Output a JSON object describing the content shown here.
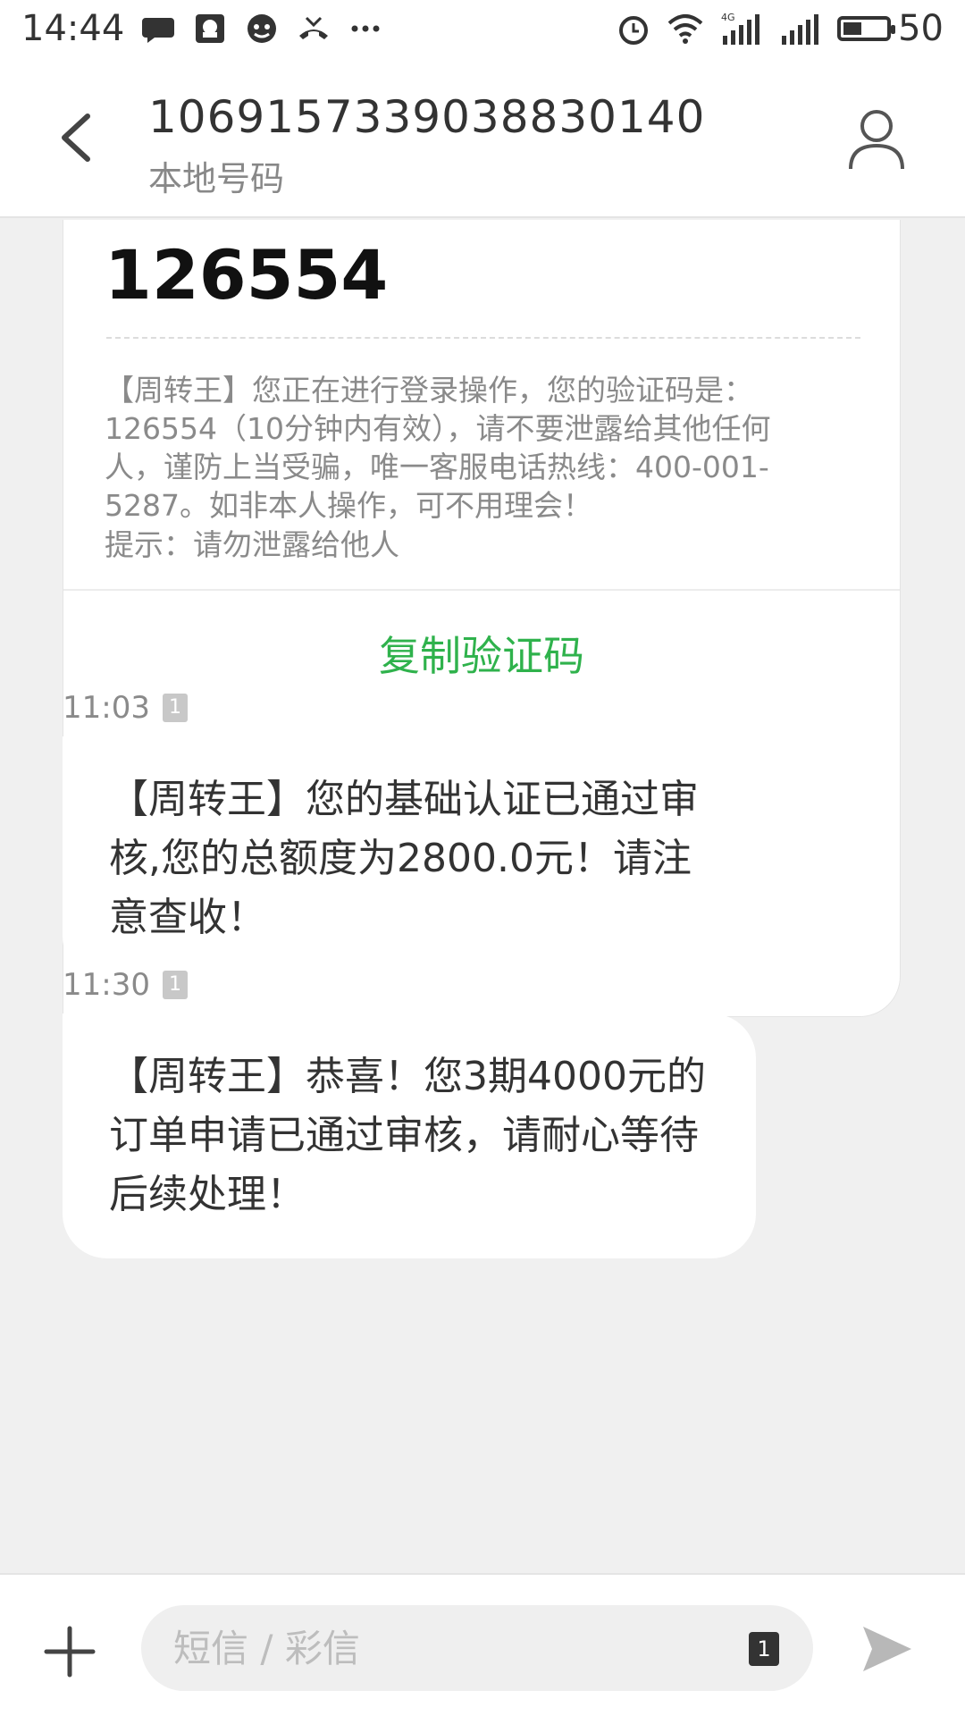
{
  "status_bar": {
    "time": "14:44",
    "battery": "50",
    "battery_level": 0.5,
    "left_icons": [
      "chat-bubble-icon",
      "qq-icon",
      "wechat-icon",
      "missed-call-icon",
      "more-dots-icon"
    ],
    "right_icons": [
      "alarm-icon",
      "wifi-icon",
      "signal-4g-icon",
      "signal-icon",
      "battery-icon"
    ]
  },
  "header": {
    "title": "1069157339038830140",
    "subtitle": "本地号码"
  },
  "verification_card": {
    "code": "126554",
    "body": "【周转王】您正在进行登录操作，您的验证码是：126554（10分钟内有效），请不要泄露给其他任何人，谨防上当受骗，唯一客服电话热线：400-001-5287。如非本人操作，可不用理会！",
    "tip": "提示：请勿泄露给他人",
    "copy_label": "复制验证码"
  },
  "messages": [
    {
      "time": "11:03",
      "sim": "1",
      "text": "【周转王】您的基础认证已通过审核,您的总额度为2800.0元！请注意查收！"
    },
    {
      "time": "11:30",
      "sim": "1",
      "text": "【周转王】恭喜！您3期4000元的订单申请已通过审核，请耐心等待后续处理！"
    }
  ],
  "composer": {
    "placeholder": "短信 / 彩信",
    "sim": "1"
  },
  "colors": {
    "accent_green": "#2fb24c",
    "background": "#f0f0f0"
  }
}
